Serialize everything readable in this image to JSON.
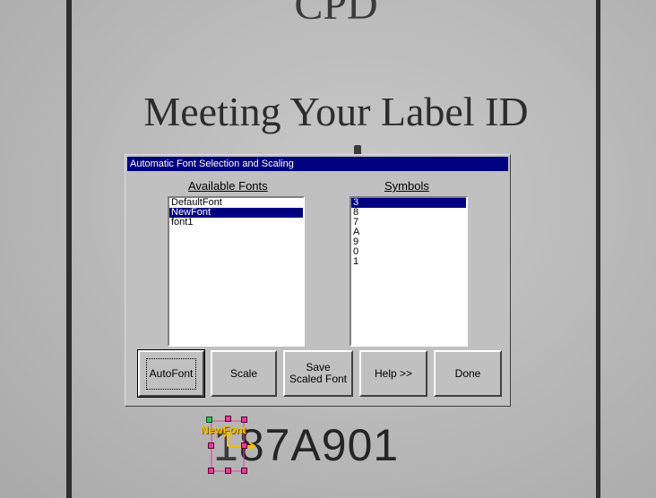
{
  "background": {
    "top_text": "CPD",
    "heading": "Meeting Your Label ID",
    "code_partial": "1",
    "code_text": "87A901"
  },
  "dialog": {
    "title": "Automatic Font Selection and Scaling",
    "fonts_header": "Available Fonts",
    "symbols_header": "Symbols",
    "fonts": [
      "DefaultFont",
      "NewFont",
      "font1"
    ],
    "selected_font": "NewFont",
    "symbols": [
      "3",
      "8",
      "7",
      "A",
      "9",
      "0",
      "1"
    ],
    "selected_symbol": "3",
    "buttons": {
      "autofont": "AutoFont",
      "scale": "Scale",
      "save_scaled_font": "Save\nScaled Font",
      "help": "Help >>",
      "done": "Done"
    }
  },
  "overlay": {
    "label": "NewFont",
    "colors": {
      "label": "#f0c000",
      "handle": "#e040a0",
      "anchor": "#30c060"
    }
  }
}
